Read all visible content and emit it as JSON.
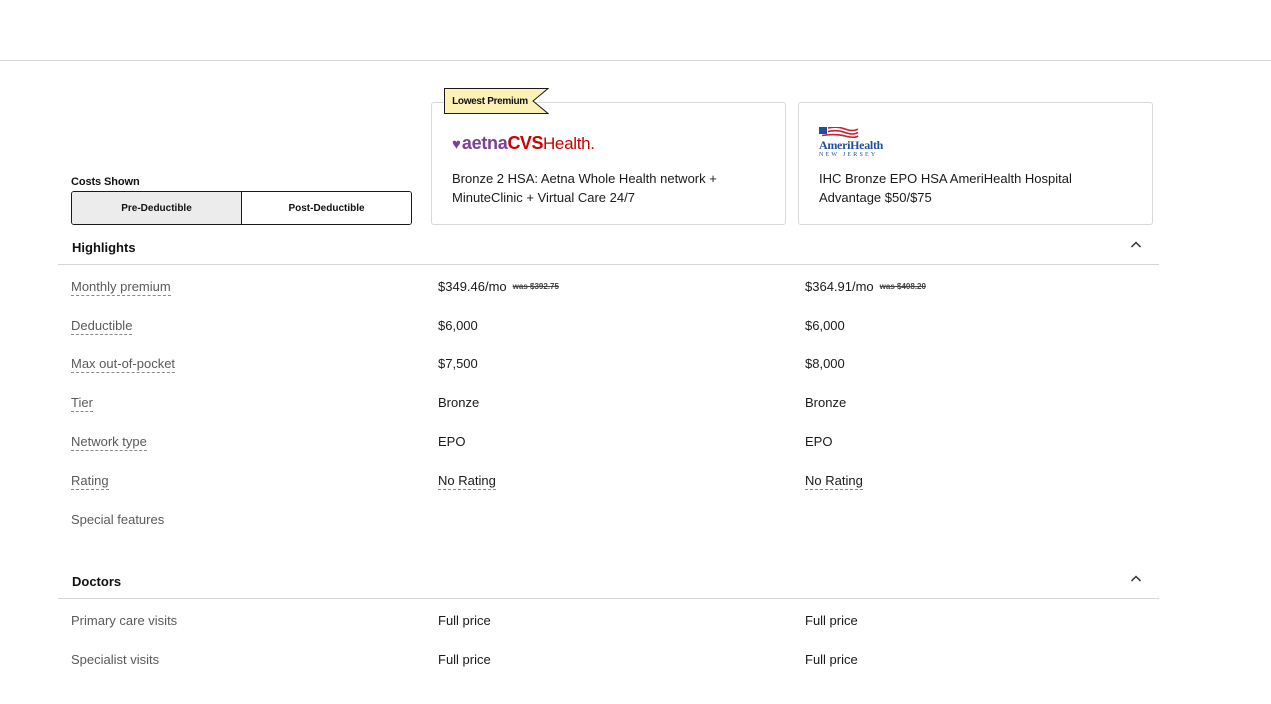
{
  "costs": {
    "label": "Costs Shown",
    "options": [
      "Pre-Deductible",
      "Post-Deductible"
    ],
    "selected": "Pre-Deductible"
  },
  "badge": "Lowest Premium",
  "plans": [
    {
      "logo": {
        "heart": "♥",
        "part1": "aetna",
        "part2": "CVS",
        "part3": "Health."
      },
      "name": "Bronze 2 HSA: Aetna Whole Health network + MinuteClinic + Virtual Care 24/7",
      "logo_colors": {
        "purple": "#7d3f98",
        "red": "#cc0000"
      }
    },
    {
      "logo": {
        "name": "AmeriHealth",
        "sub": "NEW JERSEY"
      },
      "name": "IHC Bronze EPO HSA AmeriHealth Hospital Advantage $50/$75",
      "logo_colors": {
        "blue": "#1f4e9c",
        "red": "#cc1f2e"
      }
    }
  ],
  "highlights": {
    "title": "Highlights",
    "rows": [
      {
        "label": "Monthly premium",
        "v1": "$349.46/mo",
        "v1_was": "was $392.75",
        "v2": "$364.91/mo",
        "v2_was": "was $408.20"
      },
      {
        "label": "Deductible",
        "v1": "$6,000",
        "v2": "$6,000"
      },
      {
        "label": "Max out-of-pocket",
        "v1": "$7,500",
        "v2": "$8,000"
      },
      {
        "label": "Tier",
        "v1": "Bronze",
        "v2": "Bronze"
      },
      {
        "label": "Network type",
        "v1": "EPO",
        "v2": "EPO"
      },
      {
        "label": "Rating",
        "v1": "No Rating",
        "v2": "No Rating"
      },
      {
        "label": "Special features",
        "v1": "",
        "v2": ""
      }
    ]
  },
  "doctors": {
    "title": "Doctors",
    "rows": [
      {
        "label": "Primary care visits",
        "v1": "Full price",
        "v2": "Full price"
      },
      {
        "label": "Specialist visits",
        "v1": "Full price",
        "v2": "Full price"
      }
    ]
  },
  "icons": {
    "collapse": "chevron-up-icon",
    "heart": "heart-icon",
    "flag": "flag-icon"
  }
}
